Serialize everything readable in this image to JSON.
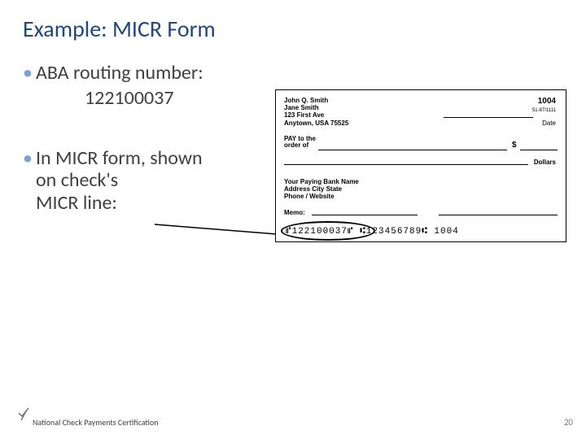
{
  "title": "Example: MICR Form",
  "bullet1": {
    "label": "ABA routing number:",
    "value": "122100037"
  },
  "bullet2": {
    "line1": "In MICR form, shown",
    "line2": "on check's",
    "line3": "MICR line:"
  },
  "check": {
    "name1": "John Q. Smith",
    "name2": "Jane Smith",
    "addr1": "123 First Ave",
    "addr2": "Anytown, USA 75525",
    "check_no": "1004",
    "fraction": "51-87/1111",
    "date_label": "Date",
    "payto_label1": "PAY to the",
    "payto_label2": "order of",
    "dollar_sign": "$",
    "dollars_label": "Dollars",
    "bank1": "Your Paying Bank Name",
    "bank2": "Address City State",
    "bank3": "Phone / Website",
    "memo_label": "Memo:",
    "micr_line": "⑈122100037⑈  ⑆123456789⑆ 1004"
  },
  "footer": {
    "text": "National Check Payments Certification",
    "page": "20"
  }
}
